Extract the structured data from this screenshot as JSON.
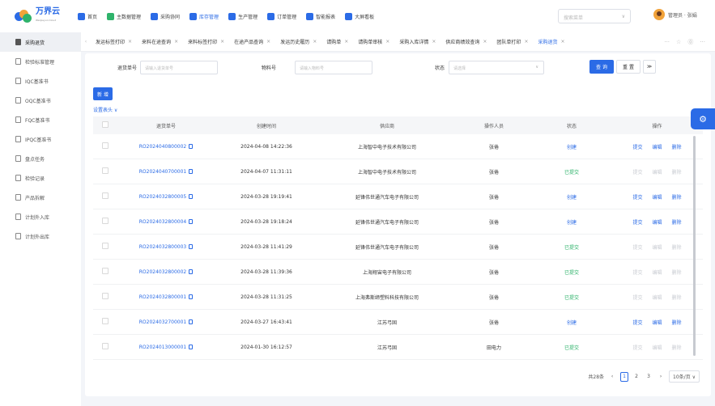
{
  "app": {
    "logo_text": "万界云",
    "logo_sub": "Wanjieyun Cloud"
  },
  "nav": [
    {
      "label": "首页",
      "icon": "home-icon",
      "color": "#2b6be6"
    },
    {
      "label": "主数据管理",
      "icon": "database-icon",
      "color": "#2fb36b"
    },
    {
      "label": "采购协同",
      "icon": "cart-icon",
      "color": "#2b6be6"
    },
    {
      "label": "库存管理",
      "icon": "warehouse-icon",
      "color": "#2b6be6",
      "active": true
    },
    {
      "label": "生产管理",
      "icon": "production-icon",
      "color": "#2b6be6"
    },
    {
      "label": "订单管理",
      "icon": "order-icon",
      "color": "#2b6be6"
    },
    {
      "label": "智能报表",
      "icon": "report-icon",
      "color": "#2b6be6"
    },
    {
      "label": "大屏看板",
      "icon": "dashboard-icon",
      "color": "#2b6be6"
    }
  ],
  "top": {
    "search_placeholder": "搜索菜单",
    "user_name": "管理员 · 张娟"
  },
  "sidebar": [
    {
      "label": "采购退货",
      "active": true
    },
    {
      "label": "检验标准管理"
    },
    {
      "label": "IQC基准书"
    },
    {
      "label": "OQC基准书"
    },
    {
      "label": "FQC基准书"
    },
    {
      "label": "IPQC基准书"
    },
    {
      "label": "盘点任务"
    },
    {
      "label": "检验记录"
    },
    {
      "label": "产品拆解"
    },
    {
      "label": "计划外入库"
    },
    {
      "label": "计划外出库"
    }
  ],
  "tabs": [
    {
      "label": "发运标签打印"
    },
    {
      "label": "来料在途查询"
    },
    {
      "label": "来料标签打印"
    },
    {
      "label": "在途产品查询"
    },
    {
      "label": "发运历史履历"
    },
    {
      "label": "请购单"
    },
    {
      "label": "请购单审核"
    },
    {
      "label": "采购入库详情"
    },
    {
      "label": "供应商绩效查询"
    },
    {
      "label": "团队单打印"
    },
    {
      "label": "采购退货",
      "active": true
    }
  ],
  "filters": {
    "return_no_label": "退货单号",
    "return_no_placeholder": "请输入退货单号",
    "material_label": "物料号",
    "material_placeholder": "请输入物料号",
    "status_label": "状态",
    "status_placeholder": "请选择",
    "query_label": "查 询",
    "reset_label": "重 置"
  },
  "actions": {
    "new_label": "新 增",
    "set_header_label": "设置表头 ∨"
  },
  "table": {
    "headers": [
      "退货单号",
      "创建时间",
      "供应商",
      "操作人员",
      "状态",
      "操作"
    ],
    "action_labels": [
      "提交",
      "编辑",
      "删除"
    ],
    "rows": [
      {
        "no": "RO2024040800002",
        "time": "2024-04-08 14:22:36",
        "supplier": "上海智中电子技术有限公司",
        "operator": "张倦",
        "status": "创建",
        "enabled": true
      },
      {
        "no": "RO2024040700001",
        "time": "2024-04-07 11:31:11",
        "supplier": "上海智中电子技术有限公司",
        "operator": "张倦",
        "status": "已提交",
        "enabled": false
      },
      {
        "no": "RO2024032800005",
        "time": "2024-03-28 19:19:41",
        "supplier": "延锋伟世通汽车电子有限公司",
        "operator": "张倦",
        "status": "创建",
        "enabled": true
      },
      {
        "no": "RO2024032800004",
        "time": "2024-03-28 19:18:24",
        "supplier": "延锋伟世通汽车电子有限公司",
        "operator": "张倦",
        "status": "创建",
        "enabled": true
      },
      {
        "no": "RO2024032800003",
        "time": "2024-03-28 11:41:29",
        "supplier": "延锋伟世通汽车电子有限公司",
        "operator": "张倦",
        "status": "已提交",
        "enabled": false
      },
      {
        "no": "RO2024032800002",
        "time": "2024-03-28 11:39:36",
        "supplier": "上海翔宙电子有限公司",
        "operator": "张倦",
        "status": "已提交",
        "enabled": false
      },
      {
        "no": "RO2024032800001",
        "time": "2024-03-28 11:31:25",
        "supplier": "上海弗斯缔塑料科技有限公司",
        "operator": "张倦",
        "status": "已提交",
        "enabled": false
      },
      {
        "no": "RO2024032700001",
        "time": "2024-03-27 16:43:41",
        "supplier": "江苏弓固",
        "operator": "张倦",
        "status": "创建",
        "enabled": true
      },
      {
        "no": "RO2024013000001",
        "time": "2024-01-30 16:12:57",
        "supplier": "江苏弓固",
        "operator": "田电力",
        "status": "已提交",
        "enabled": false
      }
    ]
  },
  "pager": {
    "total": "共28条",
    "pages": [
      "1",
      "2",
      "3"
    ],
    "current": "1",
    "size": "10条/页 ∨",
    "prev": "‹",
    "next": "›"
  },
  "colors": {
    "primary": "#2b6be6",
    "success": "#2fb36b",
    "disabled": "#c9ccd2"
  }
}
